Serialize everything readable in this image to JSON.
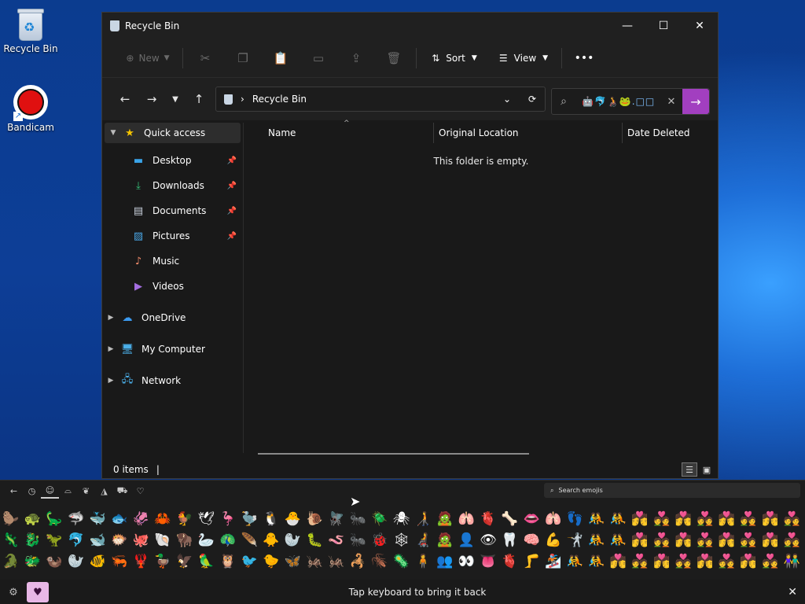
{
  "desktop": {
    "icons": [
      {
        "label": "Recycle Bin"
      },
      {
        "label": "Bandicam"
      }
    ]
  },
  "window": {
    "title": "Recycle Bin",
    "toolbar": {
      "new_label": "New",
      "sort_label": "Sort",
      "view_label": "View",
      "more_label": "•••"
    },
    "address": {
      "path": "Recycle Bin"
    },
    "search": {
      "value": "🤖🐬🧑‍🦽🐸.□□"
    },
    "sidebar": {
      "quick_access": "Quick access",
      "pinned": [
        {
          "label": "Desktop",
          "icon": "desktop-icon"
        },
        {
          "label": "Downloads",
          "icon": "download-icon"
        },
        {
          "label": "Documents",
          "icon": "document-icon"
        },
        {
          "label": "Pictures",
          "icon": "picture-icon"
        },
        {
          "label": "Music",
          "icon": "music-icon"
        },
        {
          "label": "Videos",
          "icon": "video-icon"
        }
      ],
      "onedrive": "OneDrive",
      "my_computer": "My Computer",
      "network": "Network"
    },
    "columns": {
      "name": "Name",
      "original_location": "Original Location",
      "date_deleted": "Date Deleted"
    },
    "empty_message": "This folder is empty.",
    "status": {
      "items": "0 items"
    }
  },
  "emoji_panel": {
    "search_placeholder": "Search emojis",
    "hint": "Tap keyboard to bring it back",
    "rows": [
      [
        "🦫",
        "🐢",
        "🦕",
        "🦈",
        "🐳",
        "🐟",
        "🦑",
        "🦀",
        "🐓",
        "🕊",
        "🦩",
        "🦤",
        "🐧",
        "🐣",
        "🐌",
        "🪰",
        "🐜",
        "🪲",
        "🕷",
        "🧑‍🦯",
        "🧟",
        "🫁",
        "🫀",
        "🦴",
        "👄",
        "🫁",
        "👣",
        "🤼",
        "🤼",
        "💏",
        "💑",
        "💏",
        "💑",
        "💏",
        "💑",
        "💏",
        "💑"
      ],
      [
        "🦎",
        "🐉",
        "🦖",
        "🐬",
        "🐋",
        "🐡",
        "🐙",
        "🐚",
        "🦬",
        "🦢",
        "🦚",
        "🪶",
        "🐥",
        "🦭",
        "🐛",
        "🪱",
        "🐜",
        "🐞",
        "🕸",
        "🧑‍🦼",
        "🧟",
        "👤",
        "👁",
        "🦷",
        "🧠",
        "💪",
        "🤺",
        "🤼",
        "🤼",
        "💏",
        "💑",
        "💏",
        "💑",
        "💏",
        "💑",
        "💏",
        "💑"
      ],
      [
        "🐊",
        "🐲",
        "🦦",
        "🦭",
        "🐠",
        "🦐",
        "🦞",
        "🦆",
        "🦅",
        "🦜",
        "🦉",
        "🐦",
        "🐤",
        "🦋",
        "🦗",
        "🦗",
        "🦂",
        "🪳",
        "🦠",
        "🧍",
        "👥",
        "👀",
        "👅",
        "🫀",
        "🦵",
        "🏂",
        "🤼",
        "🤼",
        "💏",
        "💑",
        "💏",
        "💑",
        "💏",
        "💑",
        "💏",
        "💑",
        "👫"
      ]
    ]
  }
}
